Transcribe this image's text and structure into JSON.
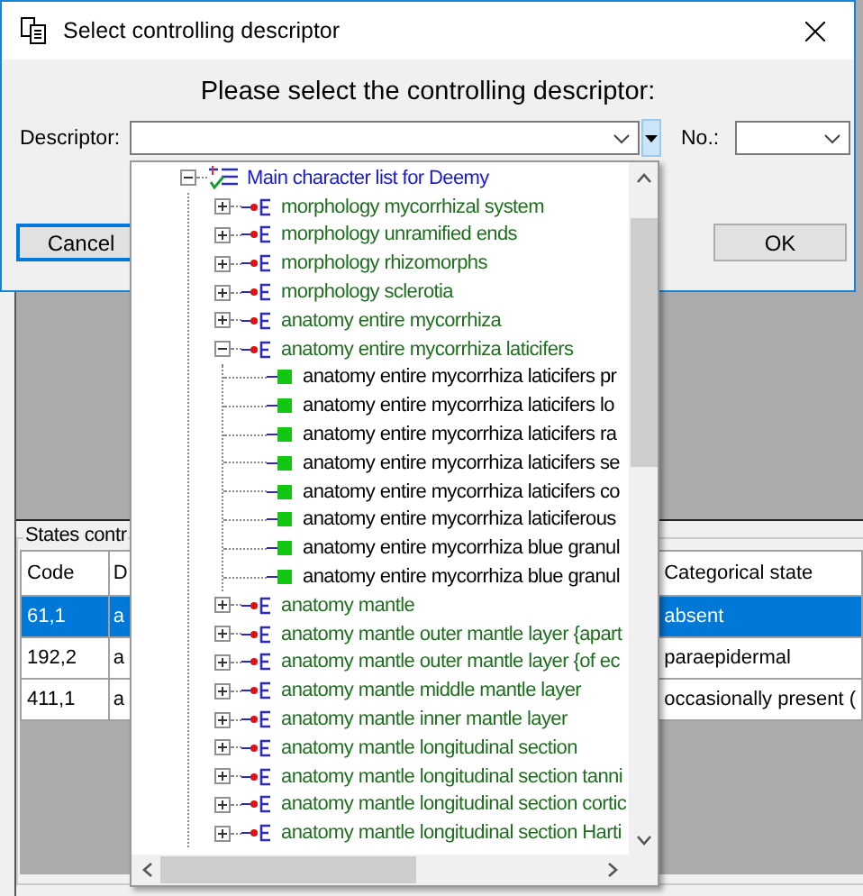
{
  "dialog": {
    "title": "Select controlling descriptor",
    "heading": "Please select the controlling descriptor:",
    "descriptor_label": "Descriptor:",
    "number_label": "No.:",
    "buttons": [
      {
        "label": "Cancel",
        "default": true
      },
      {
        "label": "OK",
        "default": false
      }
    ]
  },
  "descriptor_dropdown": {
    "tree": [
      {
        "kind": "list",
        "label": "Main character list for Deemy",
        "expanded": true,
        "children": [
          {
            "kind": "group",
            "label": "morphology mycorrhizal system",
            "expanded": false
          },
          {
            "kind": "group",
            "label": "morphology unramified ends",
            "expanded": false
          },
          {
            "kind": "group",
            "label": "morphology rhizomorphs",
            "expanded": false
          },
          {
            "kind": "group",
            "label": "morphology sclerotia",
            "expanded": false
          },
          {
            "kind": "group",
            "label": "anatomy entire mycorrhiza",
            "expanded": false
          },
          {
            "kind": "group",
            "label": "anatomy entire mycorrhiza laticifers",
            "expanded": true,
            "children": [
              {
                "kind": "character",
                "label": "anatomy entire mycorrhiza laticifers pr"
              },
              {
                "kind": "character",
                "label": "anatomy entire mycorrhiza laticifers lo"
              },
              {
                "kind": "character",
                "label": "anatomy entire mycorrhiza laticifers ra"
              },
              {
                "kind": "character",
                "label": "anatomy entire mycorrhiza laticifers se"
              },
              {
                "kind": "character",
                "label": "anatomy entire mycorrhiza laticifers co"
              },
              {
                "kind": "character",
                "label": "anatomy entire mycorrhiza laticiferous"
              },
              {
                "kind": "character",
                "label": "anatomy entire mycorrhiza blue granul"
              },
              {
                "kind": "character",
                "label": "anatomy entire mycorrhiza blue granul"
              }
            ]
          },
          {
            "kind": "group",
            "label": "anatomy mantle",
            "expanded": false
          },
          {
            "kind": "group",
            "label": "anatomy mantle outer mantle layer {apart",
            "expanded": false
          },
          {
            "kind": "group",
            "label": "anatomy mantle outer mantle layer {of ec",
            "expanded": false
          },
          {
            "kind": "group",
            "label": "anatomy mantle middle mantle layer",
            "expanded": false
          },
          {
            "kind": "group",
            "label": "anatomy mantle inner mantle layer",
            "expanded": false
          },
          {
            "kind": "group",
            "label": "anatomy mantle longitudinal section",
            "expanded": false
          },
          {
            "kind": "group",
            "label": "anatomy mantle longitudinal section tanni",
            "expanded": false
          },
          {
            "kind": "group",
            "label": "anatomy mantle longitudinal section cortic",
            "expanded": false
          },
          {
            "kind": "group",
            "label": "anatomy mantle longitudinal section Harti",
            "expanded": false
          }
        ]
      }
    ]
  },
  "states_group": {
    "title": "States contr",
    "table": {
      "columns": [
        "Code",
        "D",
        "Categorical state"
      ],
      "rows": [
        {
          "cells": [
            "61,1",
            "a",
            "absent"
          ],
          "selected": true
        },
        {
          "cells": [
            "192,2",
            "a",
            "paraepidermal"
          ],
          "selected": false
        },
        {
          "cells": [
            "411,1",
            "a",
            "occasionally present ("
          ],
          "selected": false
        }
      ]
    }
  }
}
